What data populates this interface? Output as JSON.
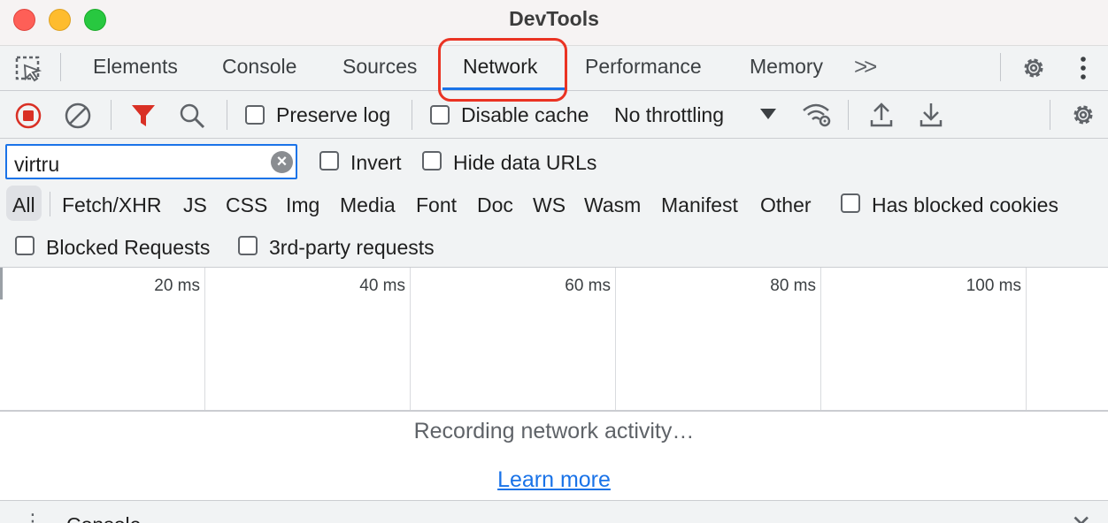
{
  "window": {
    "title": "DevTools"
  },
  "tabs": {
    "items": [
      {
        "label": "Elements"
      },
      {
        "label": "Console"
      },
      {
        "label": "Sources"
      },
      {
        "label": "Network"
      },
      {
        "label": "Performance"
      },
      {
        "label": "Memory"
      }
    ],
    "overflow_label": ">>",
    "active": "Network"
  },
  "toolbar": {
    "preserve_log_label": "Preserve log",
    "preserve_log_checked": false,
    "disable_cache_label": "Disable cache",
    "disable_cache_checked": false,
    "throttling_value": "No throttling"
  },
  "filter": {
    "search_value": "virtru",
    "invert_label": "Invert",
    "hide_data_urls_label": "Hide data URLs",
    "types": [
      "All",
      "Fetch/XHR",
      "JS",
      "CSS",
      "Img",
      "Media",
      "Font",
      "Doc",
      "WS",
      "Wasm",
      "Manifest",
      "Other"
    ],
    "active_type": "All",
    "has_blocked_cookies_label": "Has blocked cookies",
    "blocked_requests_label": "Blocked Requests",
    "third_party_label": "3rd-party requests"
  },
  "timeline": {
    "ticks": [
      "20 ms",
      "40 ms",
      "60 ms",
      "80 ms",
      "100 ms"
    ]
  },
  "empty_state": {
    "message": "Recording network activity…",
    "link": "Learn more"
  },
  "drawer": {
    "title": "Console"
  },
  "colors": {
    "accent": "#1a73e8",
    "record_red": "#d93025",
    "highlight_red": "#ea3323"
  }
}
